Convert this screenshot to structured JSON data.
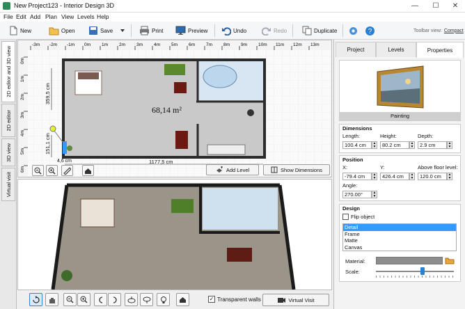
{
  "window": {
    "title": "New Project123 - Interior Design 3D",
    "minimize": "—",
    "maximize": "☐",
    "close": "✕"
  },
  "menu": [
    "File",
    "Edit",
    "Add",
    "Plan",
    "View",
    "Levels",
    "Help"
  ],
  "toolbar": {
    "new": "New",
    "open": "Open",
    "save": "Save",
    "print": "Print",
    "preview": "Preview",
    "undo": "Undo",
    "redo": "Redo",
    "duplicate": "Duplicate",
    "toolbar_view_label": "Toolbar view:",
    "toolbar_view_value": "Compact"
  },
  "side_tabs": [
    "2D editor and 3D view",
    "2D editor",
    "3D view",
    "Virtual visit"
  ],
  "plan": {
    "ruler_top": [
      "-3m",
      "-2m",
      "-1m",
      "0m",
      "1m",
      "2m",
      "3m",
      "4m",
      "5m",
      "6m",
      "7m",
      "8m",
      "9m",
      "10m",
      "11m",
      "12m",
      "13m"
    ],
    "ruler_top_label": "0m",
    "ruler_left": [
      "0m",
      "1m",
      "2m",
      "3m",
      "4m",
      "5m",
      "6m"
    ],
    "area": "68,14 m²",
    "dim_359": "359,5 cm",
    "dim_151": "151,1 cm",
    "dim_46": "4,6 cm",
    "dim_width": "1177,5 cm",
    "add_level": "Add Level",
    "show_dimensions": "Show Dimensions"
  },
  "bottom": {
    "transparent_walls": "Transparent walls",
    "transparent_walls_checked": true,
    "virtual_visit": "Virtual Visit"
  },
  "panel": {
    "tabs": [
      "Project",
      "Levels",
      "Properties"
    ],
    "active_tab": "Properties",
    "preview_caption": "Painting",
    "dimensions": {
      "heading": "Dimensions",
      "length_label": "Length:",
      "length": "100.4 cm",
      "height_label": "Height:",
      "height": "80.2 cm",
      "depth_label": "Depth:",
      "depth": "2.9 cm"
    },
    "position": {
      "heading": "Position",
      "x_label": "X:",
      "x": "-79.4 cm",
      "y_label": "Y:",
      "y": "426.4 cm",
      "above_label": "Above floor level:",
      "above": "120.0 cm",
      "angle_label": "Angle:",
      "angle": "270.00°"
    },
    "design": {
      "heading": "Design",
      "flip": "Flip object",
      "flip_checked": false,
      "options": [
        "Detail",
        "Frame",
        "Matte",
        "Canvas"
      ],
      "selected": "Detail",
      "material_label": "Material:",
      "scale_label": "Scale:",
      "scale_level": 0.6
    }
  },
  "colors": {
    "accent": "#3399ff",
    "selection": "#3399ff",
    "floor_plan": "#c9c9c9",
    "wall": "#2b2b2b"
  }
}
